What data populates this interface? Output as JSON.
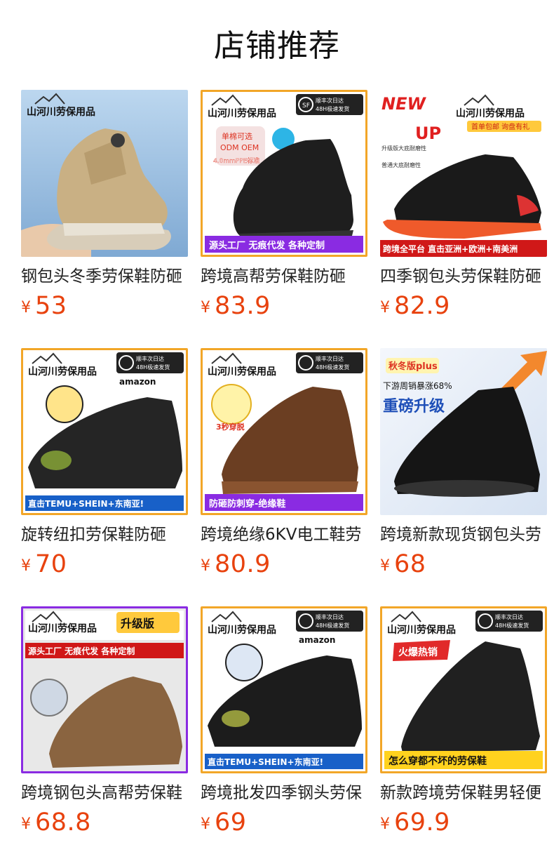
{
  "section": {
    "title": "店铺推荐"
  },
  "products": [
    {
      "name": "钢包头冬季劳保鞋防砸",
      "currency": "¥",
      "price": "53",
      "image": {
        "brand": "山河川劳保用品",
        "shoe_color": "#c9b084",
        "background": "#9fc4e6",
        "badges": []
      }
    },
    {
      "name": "跨境高帮劳保鞋防砸",
      "currency": "¥",
      "price": "83.9",
      "image": {
        "brand": "山河川劳保用品",
        "shoe_color": "#1e1e1e",
        "background": "#ffffff",
        "badges": [
          "顺丰次日达",
          "48H极速发货",
          "单棉可选",
          "ODM OEM",
          "4.0mmPPE标准",
          "源头工厂 无痕代发 各种定制"
        ]
      }
    },
    {
      "name": "四季钢包头劳保鞋防砸",
      "currency": "¥",
      "price": "82.9",
      "image": {
        "brand": "山河川劳保用品",
        "shoe_color": "#1a1a1a",
        "background": "#ffffff",
        "badges": [
          "NEW",
          "首单包邮 询盘有礼",
          "UP",
          "升级版大底耐磨性",
          "普通大底耐磨性",
          "跨境全平台 直击亚洲+欧洲+南美洲"
        ]
      }
    },
    {
      "name": "旋转纽扣劳保鞋防砸",
      "currency": "¥",
      "price": "70",
      "image": {
        "brand": "山河川劳保用品",
        "shoe_color": "#252525",
        "background": "#ffffff",
        "badges": [
          "顺丰次日达",
          "48H极速发货",
          "amazon",
          "直击TEMU+SHEIN+东南亚!"
        ]
      }
    },
    {
      "name": "跨境绝缘6KV电工鞋劳",
      "currency": "¥",
      "price": "80.9",
      "image": {
        "brand": "山河川劳保用品",
        "shoe_color": "#6b3e22",
        "background": "#ffffff",
        "badges": [
          "顺丰次日达",
          "48H极速发货",
          "3秒穿脱",
          "防砸防刺穿-绝缘鞋"
        ]
      }
    },
    {
      "name": "跨境新款现货钢包头劳",
      "currency": "¥",
      "price": "68",
      "image": {
        "brand": "",
        "shoe_color": "#151515",
        "background": "#eef3fb",
        "badges": [
          "秋冬版plus",
          "下游周销暴涨68%",
          "重磅升级"
        ]
      }
    },
    {
      "name": "跨境钢包头高帮劳保鞋",
      "currency": "¥",
      "price": "68.8",
      "image": {
        "brand": "山河川劳保用品",
        "shoe_color": "#8a6440",
        "background": "#ffffff",
        "badges": [
          "升级版",
          "源头工厂 无痕代发 各种定制"
        ]
      }
    },
    {
      "name": "跨境批发四季钢头劳保",
      "currency": "¥",
      "price": "69",
      "image": {
        "brand": "山河川劳保用品",
        "shoe_color": "#1c1c1c",
        "background": "#ffffff",
        "badges": [
          "顺丰次日达",
          "48H极速发货",
          "amazon",
          "直击TEMU+SHEIN+东南亚!"
        ]
      }
    },
    {
      "name": "新款跨境劳保鞋男轻便",
      "currency": "¥",
      "price": "69.9",
      "image": {
        "brand": "山河川劳保用品",
        "shoe_color": "#202020",
        "background": "#ffffff",
        "badges": [
          "顺丰次日达",
          "48H极速发货",
          "火爆热销",
          "怎么穿都不坏的劳保鞋"
        ]
      }
    }
  ]
}
